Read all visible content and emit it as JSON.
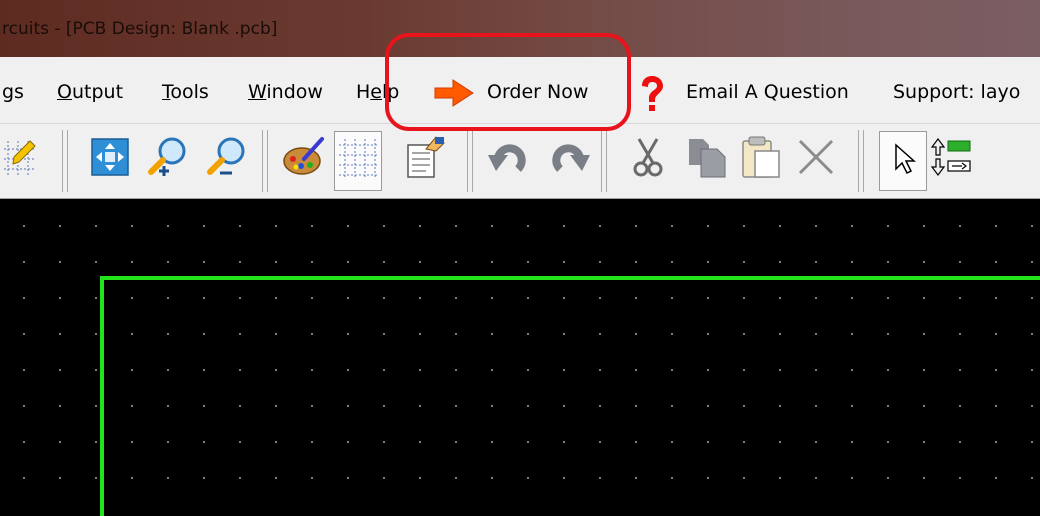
{
  "window": {
    "title": "rcuits - [PCB Design: Blank .pcb]"
  },
  "menu": {
    "items": [
      {
        "pre": "",
        "mn": "",
        "post": "gs"
      },
      {
        "pre": "",
        "mn": "O",
        "post": "utput"
      },
      {
        "pre": "",
        "mn": "T",
        "post": "ools"
      },
      {
        "pre": "",
        "mn": "W",
        "post": "indow"
      },
      {
        "pre": "H",
        "mn": "e",
        "post": "lp"
      }
    ],
    "order_now": "Order Now",
    "email_question": "Email A Question",
    "support": "Support: layo"
  },
  "icons": {
    "order": "orange-arrow-icon",
    "question": "red-question-mark-icon",
    "toolbar": [
      "grid-pencil-icon",
      "fit-board-icon",
      "zoom-in-icon",
      "zoom-out-icon",
      "palette-icon",
      "grid-icon",
      "properties-icon",
      "undo-icon",
      "redo-icon",
      "cut-icon",
      "copy-icon",
      "paste-icon",
      "delete-icon",
      "pointer-icon",
      "layer-swap-icon"
    ]
  },
  "colors": {
    "highlight": "#e8141c",
    "board_outline": "#22e41b",
    "canvas": "#000000"
  }
}
